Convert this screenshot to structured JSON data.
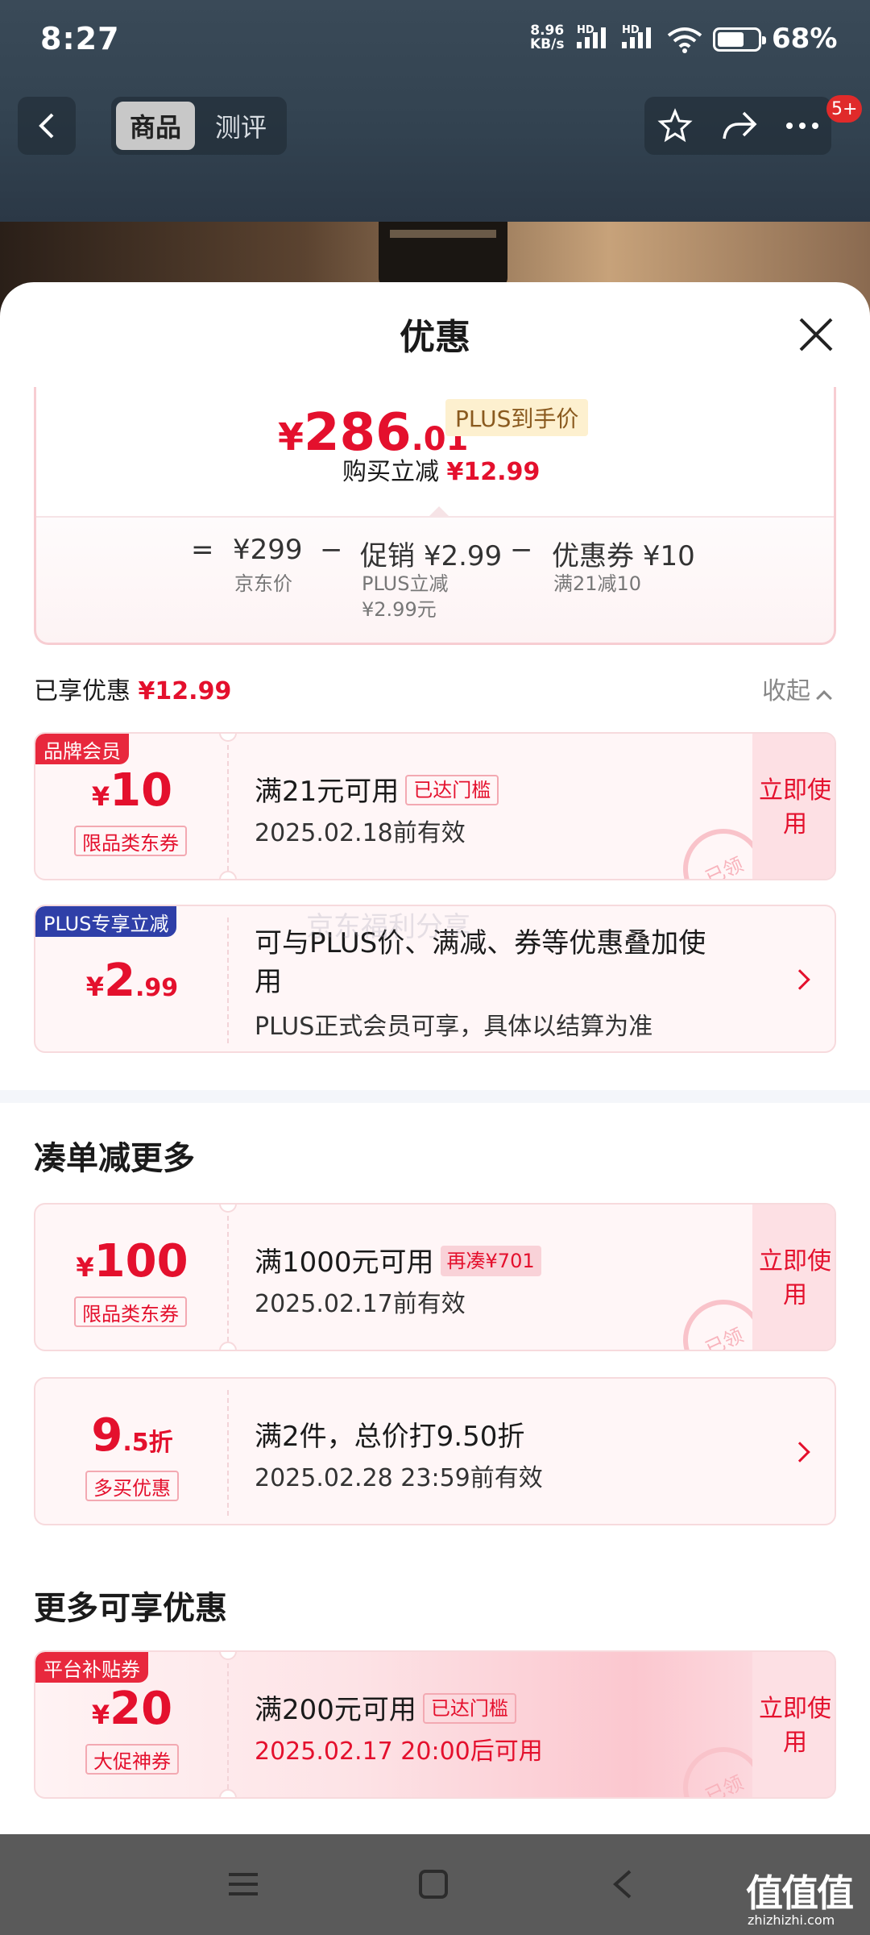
{
  "status": {
    "time": "8:27",
    "net_speed_top": "8.96",
    "net_speed_unit": "KB/s",
    "hd1": "HD",
    "hd2": "HD",
    "battery_pct": "68%"
  },
  "nav": {
    "tab_product": "商品",
    "tab_review": "测评",
    "badge": "5+"
  },
  "sheet": {
    "title": "优惠",
    "price": {
      "currency": "¥",
      "integer": "286",
      "decimal": ".01",
      "tag": "PLUS到手价",
      "reduce_label": "购买立减",
      "reduce_value": "¥12.99"
    },
    "formula": {
      "eq": "=",
      "minus": "−",
      "jd_price": "¥299",
      "jd_label": "京东价",
      "promo_label": "促销",
      "promo_value": "¥2.99",
      "promo_sub1": "PLUS立减",
      "promo_sub2": "¥2.99元",
      "coupon_label": "优惠券",
      "coupon_value": "¥10",
      "coupon_sub": "满21减10"
    },
    "enjoyed": {
      "label": "已享优惠",
      "value": "¥12.99",
      "collapse": "收起"
    },
    "applied": [
      {
        "corner": "品牌会员",
        "currency": "¥",
        "amount": "10",
        "type": "限品类东券",
        "line1": "满21元可用",
        "tag": "已达门槛",
        "line2": "2025.02.18前有效",
        "use": "立即使用",
        "stamp": "已领"
      },
      {
        "corner": "PLUS专享立减",
        "currency": "¥",
        "amount": "2",
        "decimal": ".99",
        "line1": "可与PLUS价、满减、券等优惠叠加使",
        "line1b": "用",
        "line2": "PLUS正式会员可享，具体以结算为准"
      }
    ],
    "watermark": "京东福利分享",
    "section_more": "凑单减更多",
    "more": [
      {
        "currency": "¥",
        "amount": "100",
        "type": "限品类东券",
        "line1": "满1000元可用",
        "tag": "再凑¥701",
        "line2": "2025.02.17前有效",
        "use": "立即使用",
        "stamp": "已领"
      },
      {
        "amount": "9",
        "decimal": ".5折",
        "type": "多买优惠",
        "line1": "满2件，总价打9.50折",
        "line2": "2025.02.28 23:59前有效"
      }
    ],
    "section_extra": "更多可享优惠",
    "extra": [
      {
        "corner": "平台补贴券",
        "currency": "¥",
        "amount": "20",
        "type": "大促神券",
        "line1": "满200元可用",
        "tag": "已达门槛",
        "line2": "2025.02.17 20:00后可用",
        "use": "立即使用",
        "stamp": "已领"
      }
    ]
  },
  "brand": {
    "logo": "值值值",
    "site": "zhizhizhi.com"
  },
  "colors": {
    "accent_red": "#e4102d",
    "plus_blue": "#2f3fa8",
    "brand_corner_red": "#e8283d"
  },
  "icons": [
    "back-icon",
    "star-icon",
    "share-icon",
    "more-icon",
    "close-icon",
    "chevron-up-icon",
    "chevron-right-icon",
    "menu-icon",
    "home-icon",
    "back-nav-icon"
  ]
}
